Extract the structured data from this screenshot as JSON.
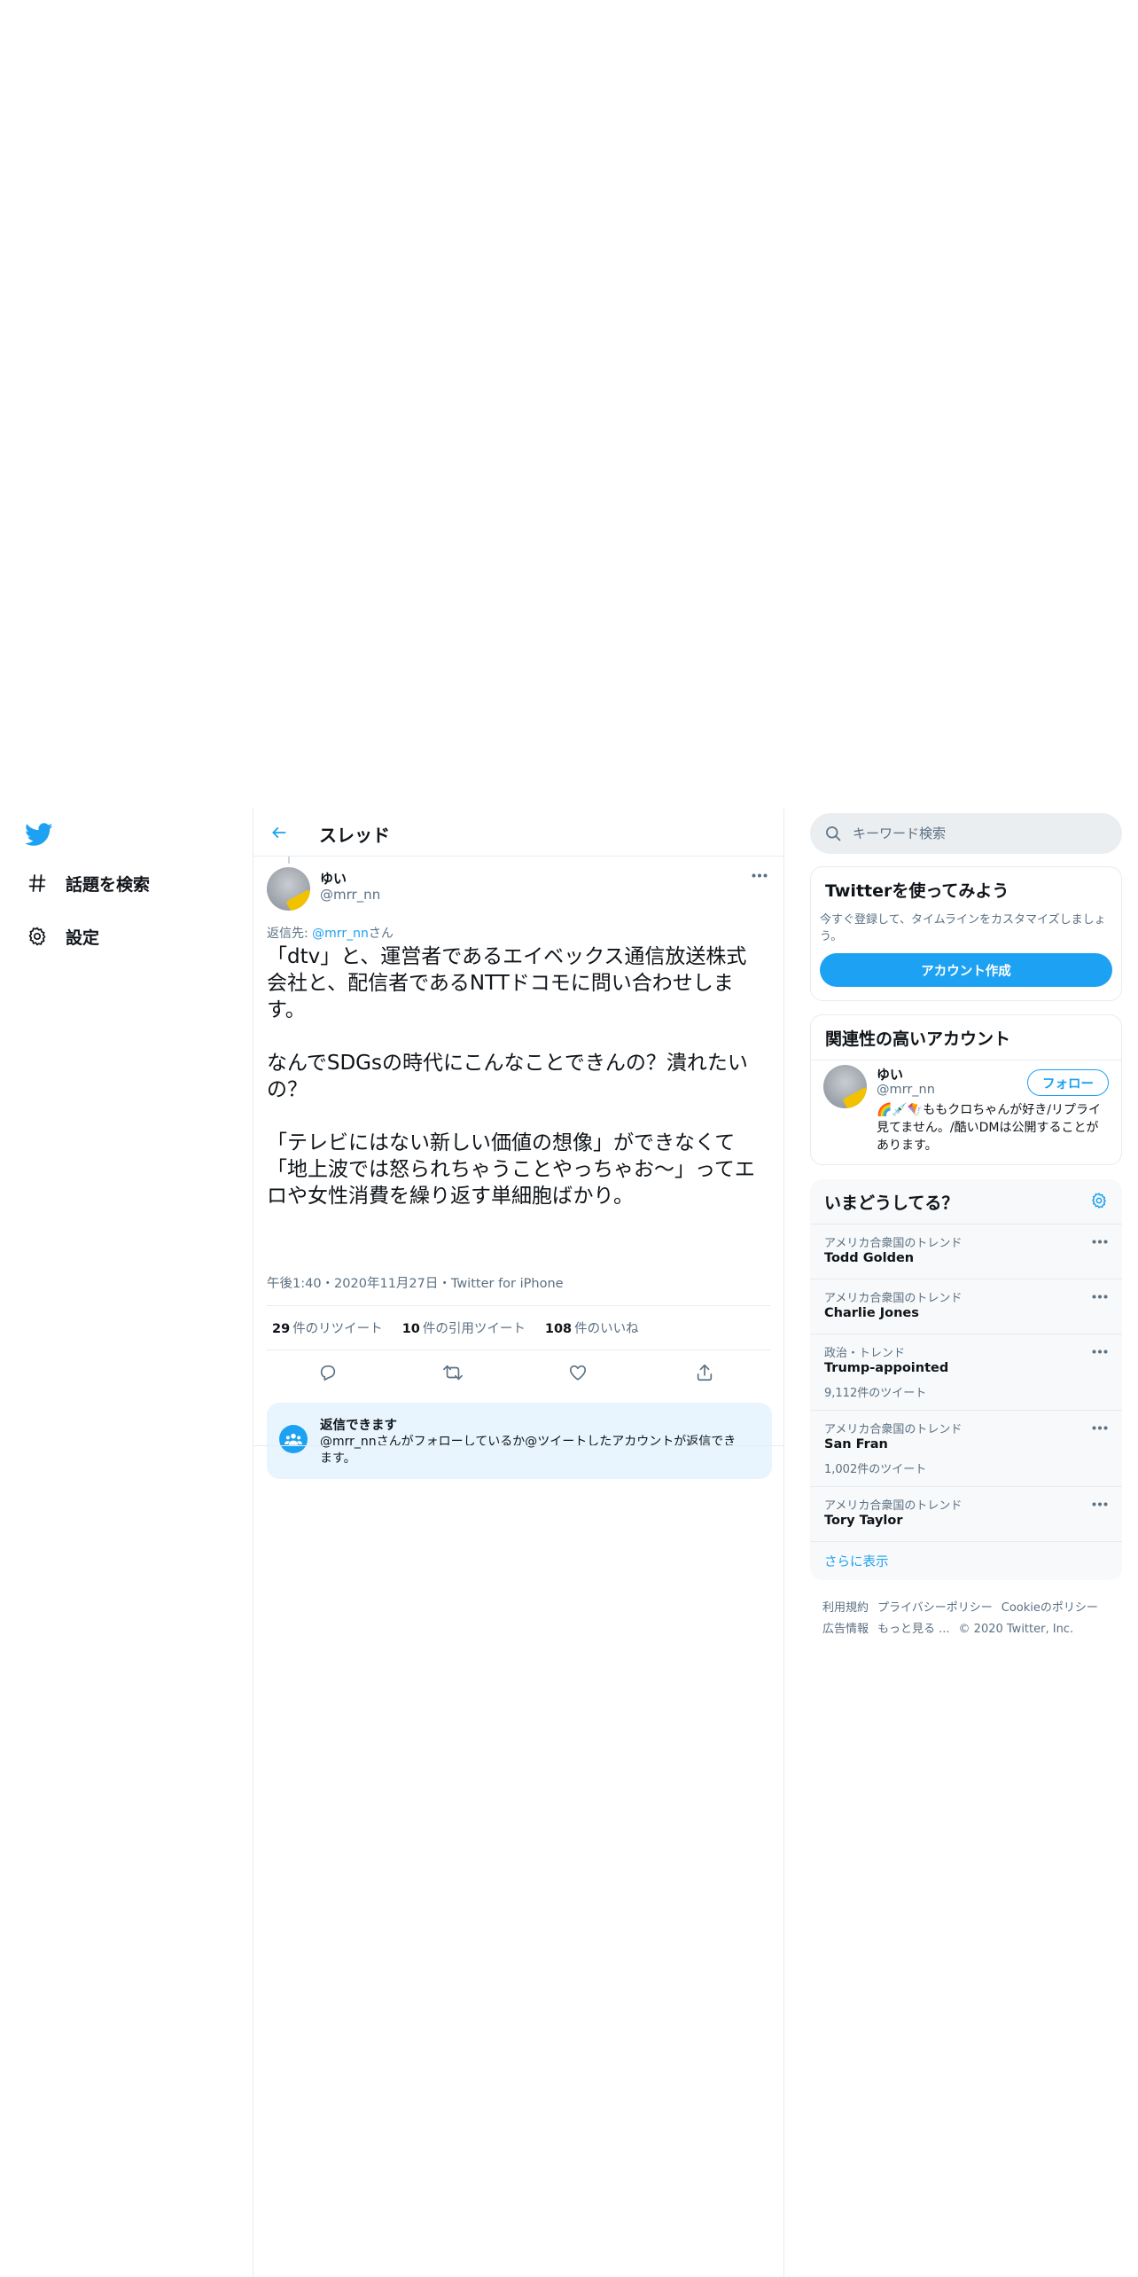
{
  "nav": {
    "items": [
      {
        "label": "話題を検索",
        "icon": "hashtag-icon"
      },
      {
        "label": "設定",
        "icon": "gear-icon"
      }
    ]
  },
  "thread": {
    "title": "スレッド"
  },
  "tweet": {
    "author_name": "ゆい",
    "author_handle": "@mrr_nn",
    "reply_prefix": "返信先: ",
    "reply_mention": "@mrr_nn",
    "reply_suffix": "さん",
    "text": "「dtv」と、運営者であるエイベックス通信放送株式会社と、配信者であるNTTドコモに問い合わせします。\n\nなんでSDGsの時代にこんなことできんの？潰れたいの？\n\n「テレビにはない新しい価値の想像」ができなくて「地上波では怒られちゃうことやっちゃお〜」ってエロや女性消費を繰り返す単細胞ばかり。",
    "meta": "午後1:40・2020年11月27日・Twitter for iPhone",
    "retweets_count": "29",
    "retweets_label": "件のリツイート",
    "quotes_count": "10",
    "quotes_label": "件の引用ツイート",
    "likes_count": "108",
    "likes_label": "件のいいね"
  },
  "reply_notice": {
    "title": "返信できます",
    "desc": "@mrr_nnさんがフォローしているか@ツイートしたアカウントが返信できます。"
  },
  "search": {
    "placeholder": "キーワード検索"
  },
  "signup": {
    "title": "Twitterを使ってみよう",
    "desc": "今すぐ登録して、タイムラインをカスタマイズしましょう。",
    "button": "アカウント作成"
  },
  "related": {
    "title": "関連性の高いアカウント",
    "name": "ゆい",
    "handle": "@mrr_nn",
    "follow": "フォロー",
    "bio": "🌈💉🪁ももクロちゃんが好き/リプライ見てません。/酷いDMは公開することがあります。"
  },
  "trends": {
    "title": "いまどうしてる？",
    "items": [
      {
        "context": "アメリカ合衆国のトレンド",
        "name": "Todd Golden",
        "count": ""
      },
      {
        "context": "アメリカ合衆国のトレンド",
        "name": "Charlie Jones",
        "count": ""
      },
      {
        "context": "政治・トレンド",
        "name": "Trump-appointed",
        "count": "9,112件のツイート"
      },
      {
        "context": "アメリカ合衆国のトレンド",
        "name": "San Fran",
        "count": "1,002件のツイート"
      },
      {
        "context": "アメリカ合衆国のトレンド",
        "name": "Tory Taylor",
        "count": ""
      }
    ],
    "show_more": "さらに表示"
  },
  "footer": {
    "links": [
      "利用規約",
      "プライバシーポリシー",
      "Cookieのポリシー",
      "広告情報",
      "もっと見る ..."
    ],
    "copyright": "© 2020 Twitter, Inc."
  },
  "colors": {
    "accent": "#1da1f2",
    "text": "#0f1419",
    "secondary": "#5b7083",
    "border": "#e6ecf0"
  }
}
